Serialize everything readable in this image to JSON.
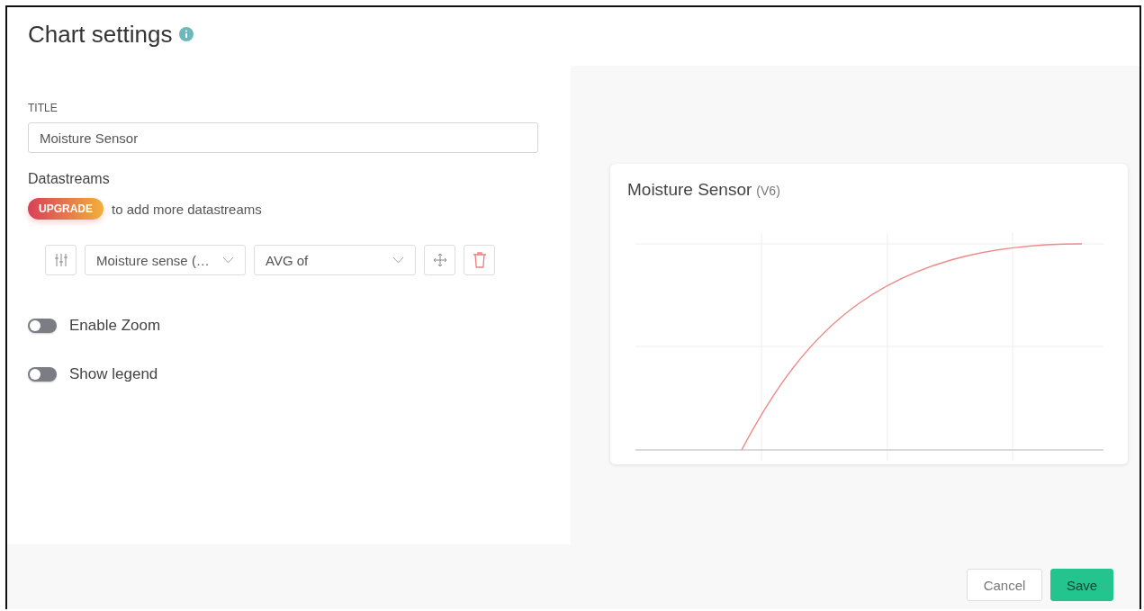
{
  "header": {
    "title": "Chart settings"
  },
  "title_field": {
    "label": "TITLE",
    "value": "Moisture Sensor"
  },
  "datastreams": {
    "heading": "Datastreams",
    "upgrade_badge": "UPGRADE",
    "upgrade_note": "to add more datastreams",
    "rows": [
      {
        "datastream": "Moisture sense (…",
        "aggregation": "AVG of"
      }
    ]
  },
  "toggles": [
    {
      "label": "Enable Zoom",
      "on": false
    },
    {
      "label": "Show legend",
      "on": false
    }
  ],
  "preview": {
    "title": "Moisture Sensor",
    "pin": "(V6)"
  },
  "buttons": [
    {
      "label": "Cancel",
      "kind": "secondary"
    },
    {
      "label": "Save",
      "kind": "primary"
    }
  ]
}
